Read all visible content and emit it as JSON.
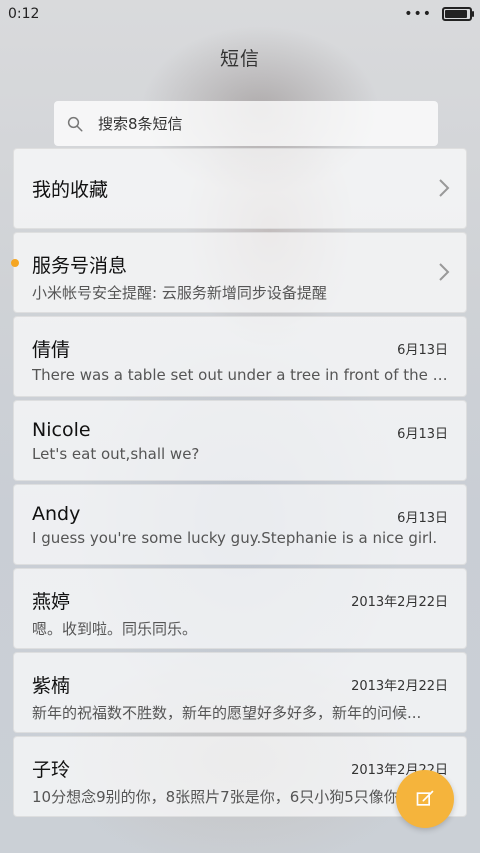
{
  "status_bar": {
    "time": "0:12",
    "more": "•••"
  },
  "page": {
    "title": "短信"
  },
  "search": {
    "placeholder": "搜索8条短信"
  },
  "sections": {
    "favorites": {
      "label": "我的收藏"
    },
    "service": {
      "label": "服务号消息",
      "preview": "小米帐号安全提醒: 云服务新增同步设备提醒"
    }
  },
  "conversations": [
    {
      "name": "倩倩",
      "date": "6月13日",
      "preview": "There was a table set out under a tree in front of the ho..."
    },
    {
      "name": "Nicole",
      "date": "6月13日",
      "preview": "Let's eat out,shall we?"
    },
    {
      "name": "Andy",
      "date": "6月13日",
      "preview": "I guess you're some lucky guy.Stephanie is a nice girl."
    },
    {
      "name": "燕婷",
      "date": "2013年2月22日",
      "preview": "嗯。收到啦。同乐同乐。"
    },
    {
      "name": "紫楠",
      "date": "2013年2月22日",
      "preview": "新年的祝福数不胜数，新年的愿望好多好多，新年的问候..."
    },
    {
      "name": "子玲",
      "date": "2013年2月22日",
      "preview": "10分想念9别的你，8张照片7张是你，6只小狗5只像你"
    }
  ],
  "colors": {
    "accent": "#f5b43c",
    "unread": "#f5a623"
  }
}
